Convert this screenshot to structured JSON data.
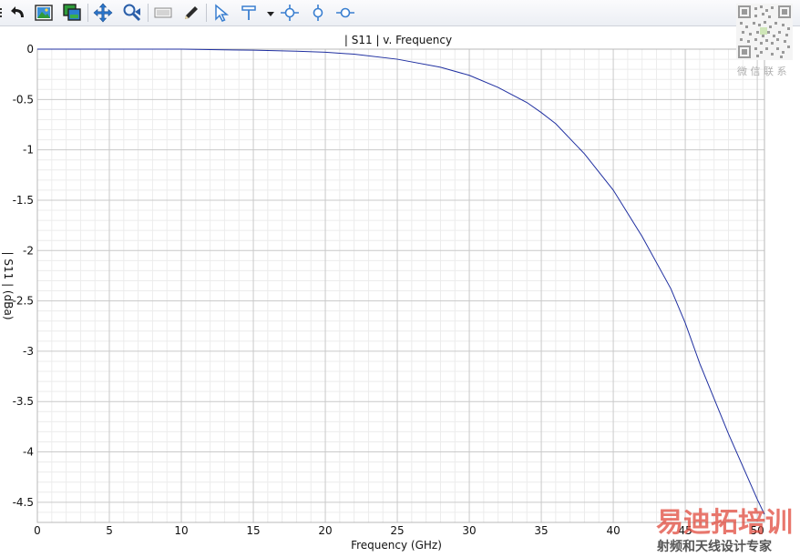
{
  "toolbar": {
    "icons": [
      "menu-edge-icon",
      "undo-icon",
      "image-icon",
      "copy-image-icon",
      "pan-icon",
      "zoom-icon",
      "legend-icon",
      "pencil-icon",
      "pointer-icon",
      "marker-dropdown-icon",
      "crosshair-icon",
      "vertical-marker-icon",
      "horizontal-marker-icon"
    ]
  },
  "watermark": {
    "contact_text": "微 信 联 系",
    "brand_text": "易迪拓培训",
    "tagline_text": "射频和天线设计专家",
    "brand_color": "#e04a3c",
    "tagline_color": "#555555"
  },
  "chart_data": {
    "type": "line",
    "title": "| S11 | v. Frequency",
    "xlabel": "Frequency (GHz)",
    "ylabel": "| S11 | (dBa)",
    "xlim": [
      0,
      50.5
    ],
    "ylim": [
      -4.7,
      0
    ],
    "x_ticks": [
      0,
      5,
      10,
      15,
      20,
      25,
      30,
      35,
      40,
      45,
      50
    ],
    "x_tick_labels": [
      "0",
      "5",
      "10",
      "15",
      "20",
      "25",
      "30",
      "35",
      "40",
      "45",
      "50"
    ],
    "y_ticks": [
      0,
      -0.5,
      -1,
      -1.5,
      -2,
      -2.5,
      -3,
      -3.5,
      -4,
      -4.5
    ],
    "y_tick_labels": [
      "0",
      "-0.5",
      "-1",
      "-1.5",
      "-2",
      "-2.5",
      "-3",
      "-3.5",
      "-4",
      "-4.5"
    ],
    "grid": true,
    "line_color": "#1f2fa0",
    "series": [
      {
        "x": [
          0,
          5,
          10,
          12,
          15,
          18,
          20,
          22,
          25,
          28,
          30,
          32,
          34,
          35,
          36,
          38,
          40,
          42,
          44,
          45,
          46,
          48,
          50,
          50.5
        ],
        "values": [
          0,
          0,
          0,
          -0.005,
          -0.01,
          -0.02,
          -0.03,
          -0.05,
          -0.1,
          -0.18,
          -0.26,
          -0.38,
          -0.53,
          -0.63,
          -0.74,
          -1.04,
          -1.4,
          -1.86,
          -2.38,
          -2.72,
          -3.12,
          -3.82,
          -4.47,
          -4.62
        ]
      }
    ]
  }
}
